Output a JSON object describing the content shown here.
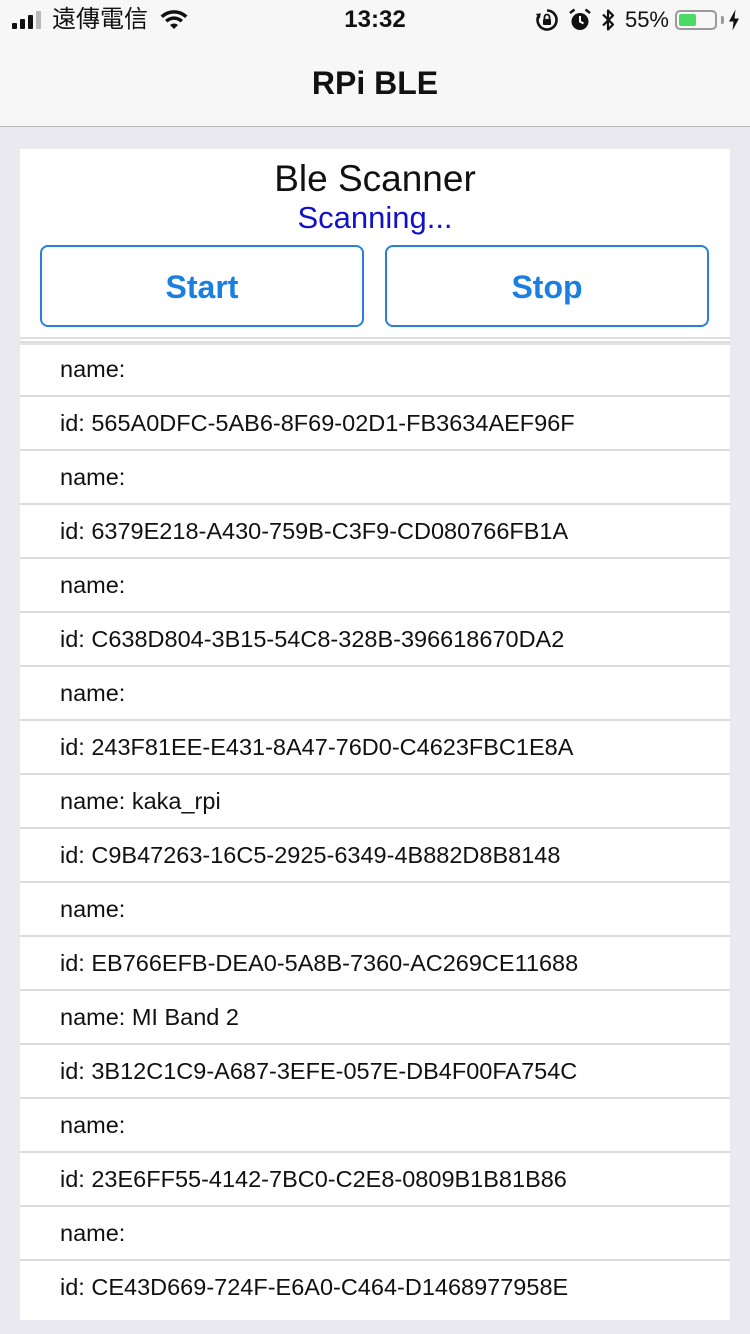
{
  "status_bar": {
    "carrier": "遠傳電信",
    "time": "13:32",
    "battery_percent": "55%",
    "battery_level": 0.55,
    "icons": [
      "signal-icon",
      "wifi-icon",
      "rotation-lock-icon",
      "alarm-icon",
      "bluetooth-icon",
      "battery-icon",
      "charging-icon"
    ]
  },
  "nav": {
    "title": "RPi BLE"
  },
  "scanner": {
    "title": "Ble Scanner",
    "status": "Scanning...",
    "start_label": "Start",
    "stop_label": "Stop"
  },
  "devices": [
    {
      "name": "name:",
      "id": "id: 565A0DFC-5AB6-8F69-02D1-FB3634AEF96F"
    },
    {
      "name": "name:",
      "id": "id: 6379E218-A430-759B-C3F9-CD080766FB1A"
    },
    {
      "name": "name:",
      "id": "id: C638D804-3B15-54C8-328B-396618670DA2"
    },
    {
      "name": "name:",
      "id": "id: 243F81EE-E431-8A47-76D0-C4623FBC1E8A"
    },
    {
      "name": "name: kaka_rpi",
      "id": "id: C9B47263-16C5-2925-6349-4B882D8B8148"
    },
    {
      "name": "name:",
      "id": "id: EB766EFB-DEA0-5A8B-7360-AC269CE11688"
    },
    {
      "name": "name: MI Band 2",
      "id": "id: 3B12C1C9-A687-3EFE-057E-DB4F00FA754C"
    },
    {
      "name": "name:",
      "id": "id: 23E6FF55-4142-7BC0-C2E8-0809B1B81B86"
    },
    {
      "name": "name:",
      "id": "id: CE43D669-724F-E6A0-C464-D1468977958E"
    }
  ],
  "colors": {
    "accent": "#1a7fe0",
    "scan_status": "#1111cc",
    "battery": "#4cd964",
    "background": "#e9e9ef"
  }
}
